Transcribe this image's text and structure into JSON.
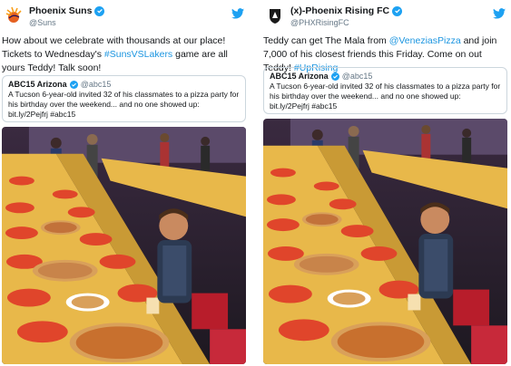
{
  "tweets": [
    {
      "name": "Phoenix Suns",
      "handle": "@Suns",
      "text_pre": "How about we celebrate with thousands at our place! Tickets to Wednesday's ",
      "hashtag": "#SunsVSLakers",
      "text_post": " game are all yours Teddy! Talk soon!",
      "quote": {
        "name": "ABC15 Arizona",
        "handle": "@abc15",
        "text": "A Tucson 6-year-old invited 32 of his classmates to a pizza party for his birthday over the weekend... and no one showed up: bit.ly/2Pejfrj #abc15"
      }
    },
    {
      "name": "(x)-Phoenix Rising FC",
      "handle": "@PHXRisingFC",
      "text_pre": "Teddy can get The Mala from ",
      "mention": "@VeneziasPizza",
      "text_mid": " and join 7,000 of his closest friends this Friday. Come on out Teddy! ",
      "hashtag": "#UpRising",
      "quote": {
        "name": "ABC15 Arizona",
        "handle": "@abc15",
        "text": "A Tucson 6-year-old invited 32 of his classmates to a pizza party for his birthday over the weekend... and no one showed up: bit.ly/2Pejfrj #abc15"
      }
    }
  ],
  "colors": {
    "link": "#1b95e0",
    "verified": "#1da1f2",
    "twitter_bird": "#1da1f2",
    "table_cloth": "#e8b84a",
    "plate": "#e0452b",
    "suns_orange": "#e56020"
  },
  "icons": [
    "suns-logo-icon",
    "rising-fc-logo-icon",
    "verified-badge-icon",
    "twitter-bird-icon"
  ]
}
